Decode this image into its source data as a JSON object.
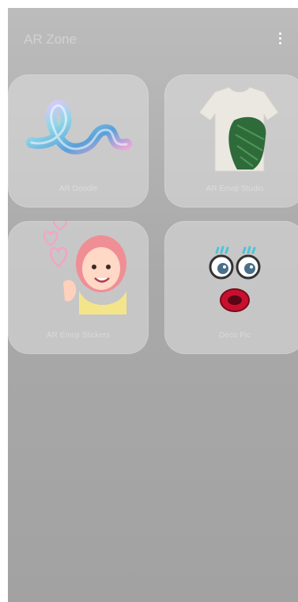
{
  "app": {
    "title": "AR Zone",
    "menu_icon": "more-options-icon"
  },
  "tiles": [
    {
      "label": "AR Doodle",
      "icon": "ar-doodle-icon"
    },
    {
      "label": "AR Emoji Studio",
      "icon": "tshirt-icon"
    },
    {
      "label": "AR Emoji Stickers",
      "icon": "avatar-heart-icon"
    },
    {
      "label": "Deco Pic",
      "icon": "face-eyes-mouth-icon"
    }
  ],
  "colors": {
    "background": "#a9a9a9",
    "tile": "#dedede"
  }
}
